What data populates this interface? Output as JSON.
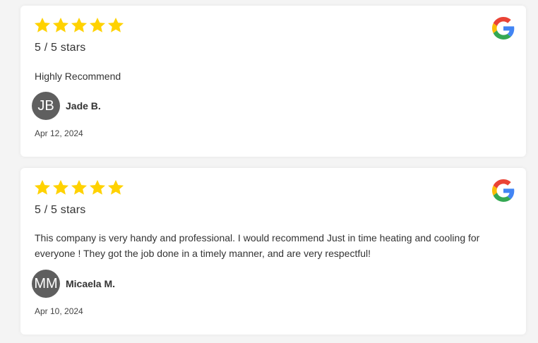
{
  "colors": {
    "star": "#FFD200",
    "avatar_bg": "#5F5F5F",
    "card_bg": "#FFFFFF"
  },
  "reviews": [
    {
      "rating": 5,
      "rating_text": "5 / 5 stars",
      "body": "Highly Recommend",
      "avatar_initials": "JB",
      "name": "Jade B.",
      "date": "Apr 12, 2024",
      "source_icon": "google-icon"
    },
    {
      "rating": 5,
      "rating_text": "5 / 5 stars",
      "body": "This company is very handy and professional. I would recommend Just in time heating and cooling for everyone ! They got the job done in a timely manner, and are very respectful!",
      "avatar_initials": "MM",
      "name": "Micaela M.",
      "date": "Apr 10, 2024",
      "source_icon": "google-icon"
    }
  ]
}
